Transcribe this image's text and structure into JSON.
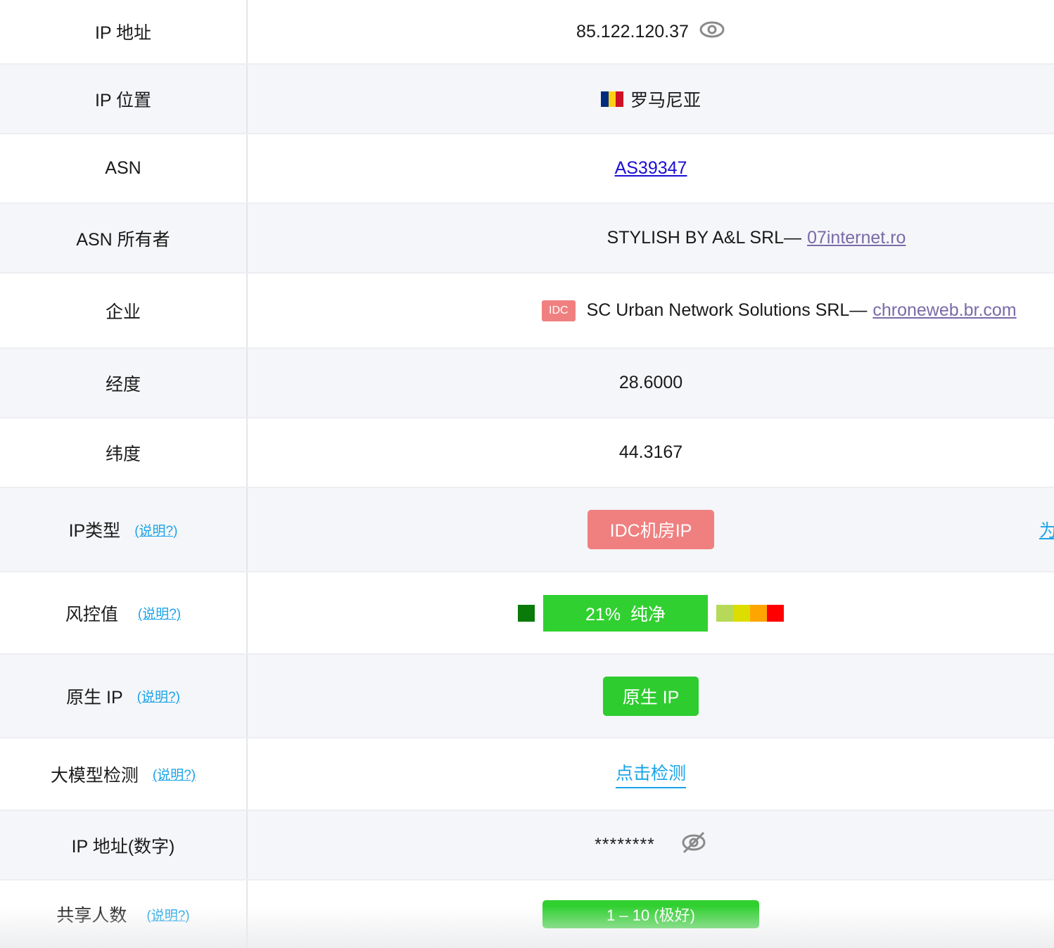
{
  "rows": [
    {
      "label": "IP 地址",
      "value": "85.122.120.37",
      "icon": "eye-icon"
    },
    {
      "label": "IP 位置",
      "value": "罗马尼亚",
      "flag_colors": [
        "#002b7f",
        "#fcd116",
        "#ce1126"
      ]
    },
    {
      "label": "ASN",
      "value": "AS39347"
    },
    {
      "label": "ASN 所有者",
      "value": "STYLISH BY A&L SRL—",
      "link": "07internet.ro"
    },
    {
      "label": "企业",
      "tag": "IDC",
      "value": "SC Urban Network Solutions SRL—",
      "link": "chroneweb.br.com"
    },
    {
      "label": "经度",
      "value": "28.6000"
    },
    {
      "label": "纬度",
      "value": "44.3167"
    },
    {
      "label": "IP类型",
      "help": "(说明?)",
      "value": "IDC机房IP",
      "edge_link": "为"
    },
    {
      "label": "风控值",
      "help": "(说明?)",
      "value": "21%  纯净",
      "risk_level": 0.21,
      "scale_colors": [
        "#b7d95a",
        "#dddd00",
        "#ffa500",
        "#ff0000"
      ],
      "low_color": "#0a7a0a",
      "bar_color": "#31d031"
    },
    {
      "label": "原生 IP",
      "help": "(说明?)",
      "value": "原生 IP"
    },
    {
      "label": "大模型检测",
      "help": "(说明?)",
      "value": "点击检测"
    },
    {
      "label": "IP 地址(数字)",
      "value": "********",
      "icon": "eye-off-icon"
    },
    {
      "label": "共享人数",
      "help": "(说明?)",
      "value": "1 – 10 (极好)"
    }
  ]
}
